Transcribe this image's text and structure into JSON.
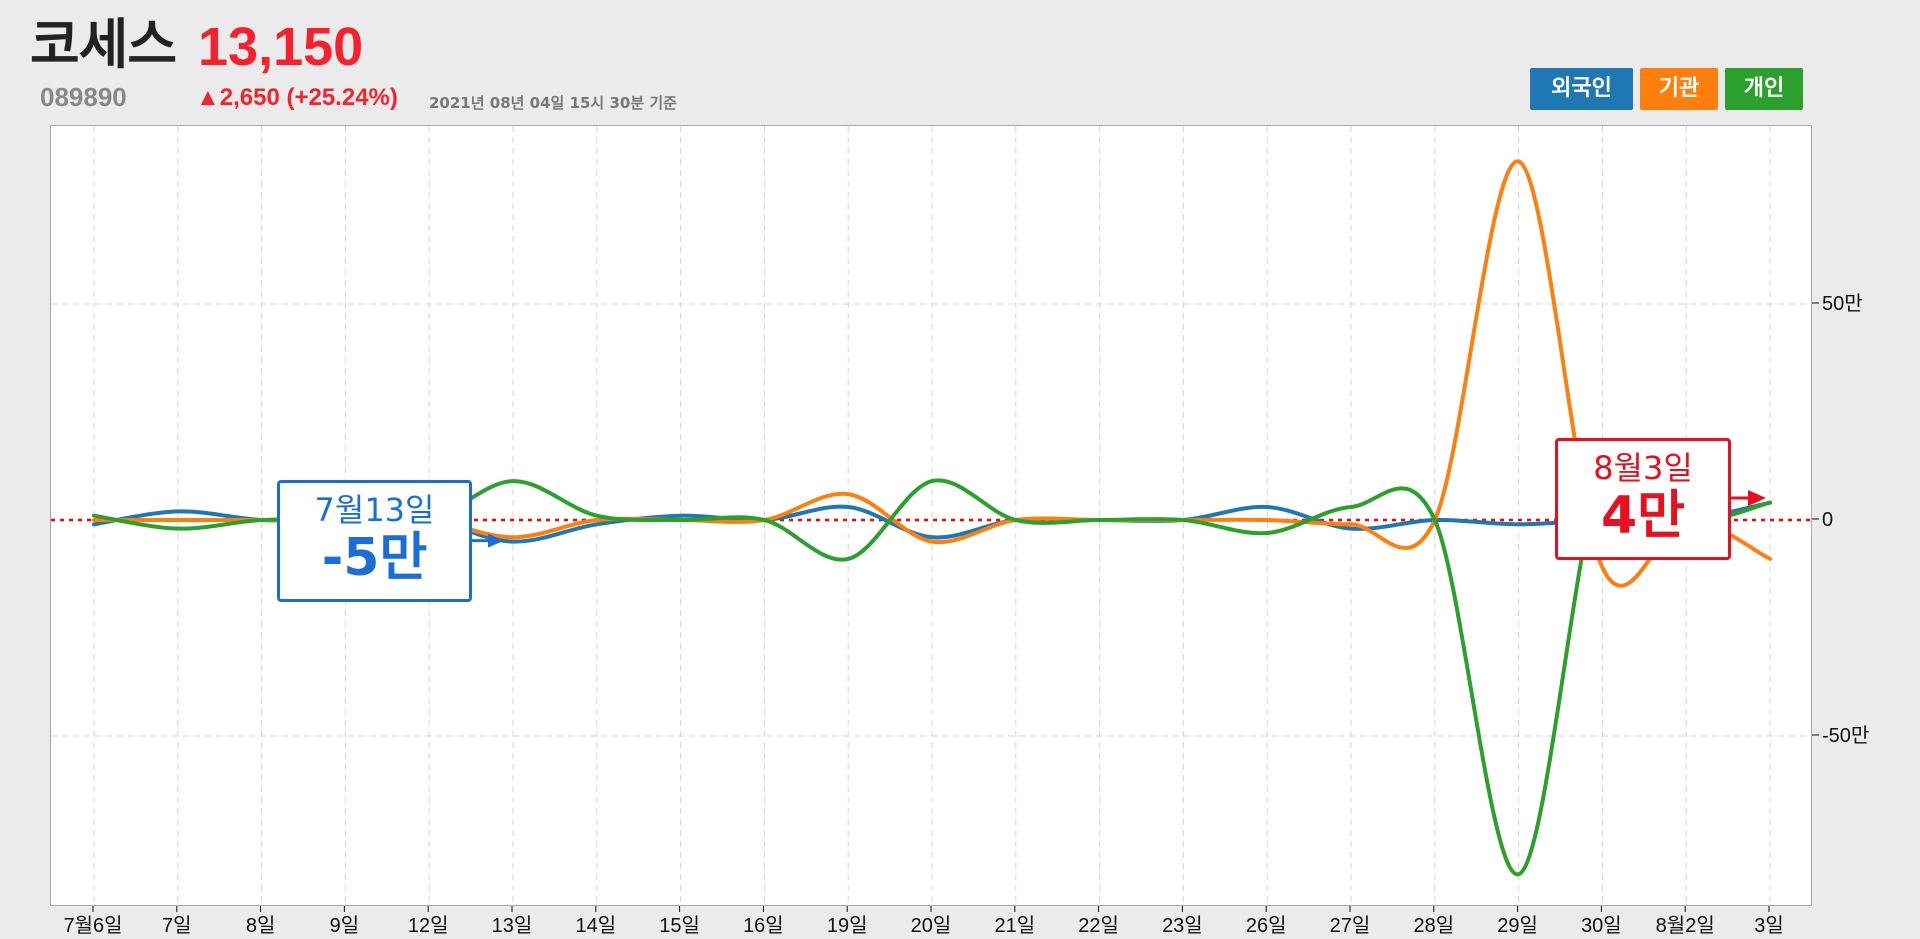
{
  "header": {
    "name": "코세스",
    "price": "13,150",
    "code": "089890",
    "change": "▲2,650 (+25.24%)",
    "asof": "2021년 08년 04일 15시 30분 기준"
  },
  "legend": [
    {
      "label": "외국인",
      "color": "#1f77b4"
    },
    {
      "label": "기관",
      "color": "#ff7f0e"
    },
    {
      "label": "개인",
      "color": "#2ca02c"
    }
  ],
  "annotations": {
    "left": {
      "date": "7월13일",
      "value": "-5만",
      "color": "#1a6fd6"
    },
    "right": {
      "date": "8월3일",
      "value": "4만",
      "color": "#e6101e"
    }
  },
  "chart_data": {
    "type": "line",
    "categories": [
      "7월6일",
      "7일",
      "8일",
      "9일",
      "12일",
      "13일",
      "14일",
      "15일",
      "16일",
      "19일",
      "20일",
      "21일",
      "22일",
      "23일",
      "26일",
      "27일",
      "28일",
      "29일",
      "30일",
      "8월2일",
      "3일"
    ],
    "y_ticks": [
      {
        "value": 50,
        "label": "50만"
      },
      {
        "value": 0,
        "label": "0"
      },
      {
        "value": -50,
        "label": "-50만"
      }
    ],
    "ylim": [
      -90,
      90
    ],
    "grid": true,
    "legend_position": "top-right",
    "zero_line": {
      "value": 0,
      "color": "#ff0000",
      "style": "dotted"
    },
    "series": [
      {
        "name": "외국인",
        "color": "#1f77b4",
        "values": [
          -1,
          2,
          0,
          0,
          0,
          -5,
          -1,
          1,
          0,
          3,
          -4,
          0,
          0,
          0,
          3,
          -2,
          0,
          -1,
          0,
          0,
          4
        ]
      },
      {
        "name": "기관",
        "color": "#ff7f0e",
        "values": [
          0,
          0,
          0,
          0,
          0,
          -4,
          0,
          0,
          0,
          6,
          -5,
          0,
          0,
          0,
          0,
          -1,
          0,
          83,
          -11,
          0,
          -9
        ]
      },
      {
        "name": "개인",
        "color": "#2ca02c",
        "values": [
          1,
          -2,
          0,
          0,
          0,
          9,
          1,
          0,
          0,
          -9,
          9,
          0,
          0,
          0,
          -3,
          3,
          0,
          -82,
          11,
          0,
          4
        ]
      }
    ]
  }
}
